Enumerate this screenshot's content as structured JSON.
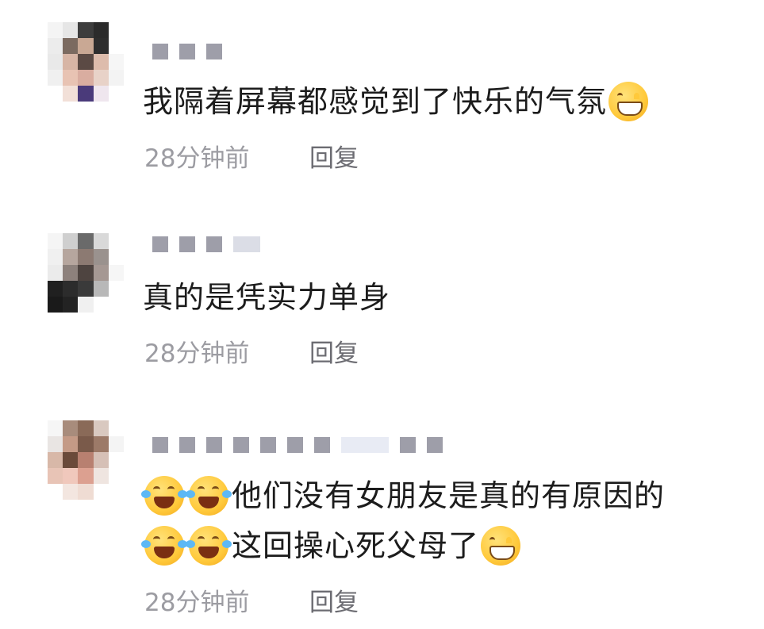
{
  "comments": [
    {
      "text": "我隔着屏幕都感觉到了快乐的气氛",
      "emoji_after": "grinning-face-icon",
      "time": "28分钟前",
      "reply_label": "回复"
    },
    {
      "text": "真的是凭实力单身",
      "time": "28分钟前",
      "reply_label": "回复"
    },
    {
      "line1_text": "他们没有女朋友是真的有原因的",
      "line2_text": "这回操心死父母了",
      "emoji_prefix": [
        "face-with-tears-of-joy-icon",
        "face-with-tears-of-joy-icon"
      ],
      "emoji_after": "grinning-sweat-icon",
      "time": "28分钟前",
      "reply_label": "回复"
    }
  ],
  "colors": {
    "text": "#1c1c1c",
    "meta": "#9c9ca2",
    "reply": "#6c6c72",
    "emoji": "#ffc93b"
  }
}
